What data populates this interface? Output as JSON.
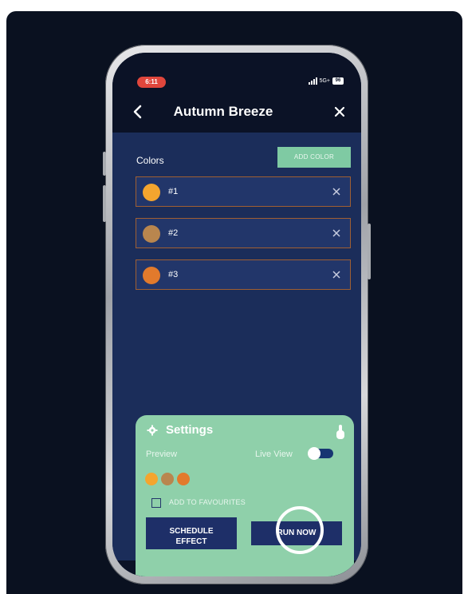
{
  "status_bar": {
    "time": "6:11",
    "network": "5G+",
    "battery": "96"
  },
  "header": {
    "title": "Autumn Breeze"
  },
  "colors_section": {
    "label": "Colors",
    "add_button": "ADD COLOR",
    "items": [
      {
        "label": "#1",
        "color": "#f4a52e"
      },
      {
        "label": "#2",
        "color": "#b9864e"
      },
      {
        "label": "#3",
        "color": "#e27a2c"
      }
    ]
  },
  "settings": {
    "title": "Settings",
    "preview_label": "Preview",
    "live_view_label": "Live View",
    "live_view_on": false,
    "preview_colors": [
      "#f4a52e",
      "#b9864e",
      "#e27a2c"
    ],
    "favourites_label": "ADD TO FAVOURITES",
    "favourites_checked": false,
    "schedule_button": "SCHEDULE\nEFFECT",
    "run_button": "RUN NOW"
  },
  "colors": {
    "background": "#0a1120",
    "screen": "#1b2d5a",
    "accent_green": "#8fd0aa",
    "button_navy": "#1e2f68",
    "row_border": "#a05f32"
  }
}
